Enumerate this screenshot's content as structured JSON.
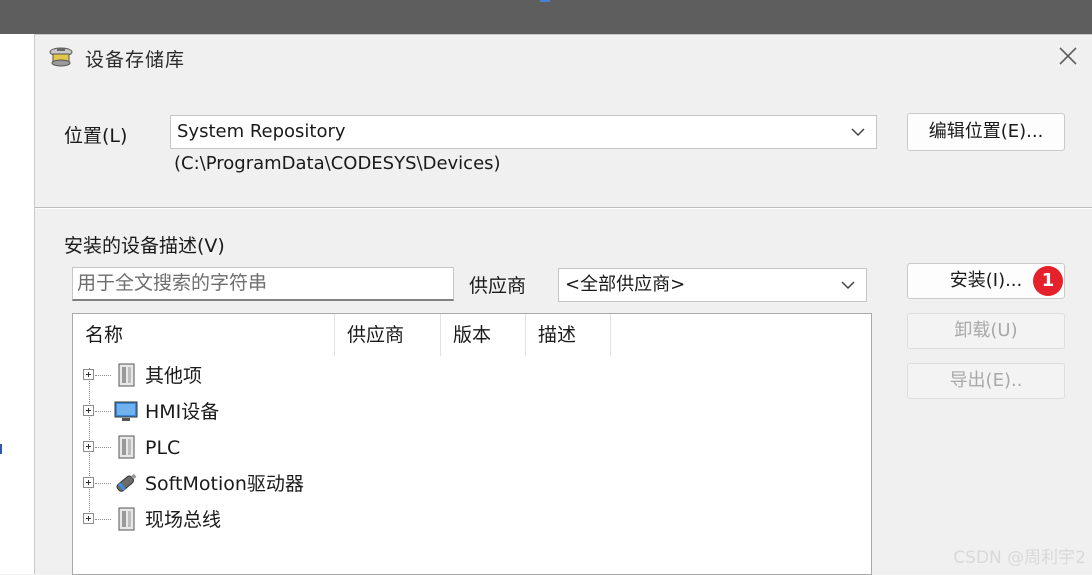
{
  "dialog": {
    "title": "设备存储库",
    "close_icon": "close-icon"
  },
  "location": {
    "label": "位置(L)",
    "selected": "System Repository",
    "path": "(C:\\ProgramData\\CODESYS\\Devices)",
    "edit_button": "编辑位置(E)..."
  },
  "installed": {
    "label": "安装的设备描述(V)",
    "search_placeholder": "用于全文搜索的字符串",
    "vendor_label": "供应商",
    "vendor_selected": "<全部供应商>"
  },
  "buttons": {
    "install": "安装(I)...",
    "install_badge": "1",
    "uninstall": "卸载(U)",
    "export": "导出(E).."
  },
  "tree": {
    "columns": [
      "名称",
      "供应商",
      "版本",
      "描述"
    ],
    "items": [
      {
        "label": "其他项",
        "icon": "device-cabinet-icon"
      },
      {
        "label": "HMI设备",
        "icon": "monitor-icon"
      },
      {
        "label": "PLC",
        "icon": "device-cabinet-icon"
      },
      {
        "label": "SoftMotion驱动器",
        "icon": "motor-drive-icon"
      },
      {
        "label": "现场总线",
        "icon": "device-cabinet-icon"
      }
    ]
  },
  "watermark": "CSDN @周利宇2",
  "colors": {
    "badge": "#e5212b",
    "accent_blue": "#4a7fd6"
  }
}
